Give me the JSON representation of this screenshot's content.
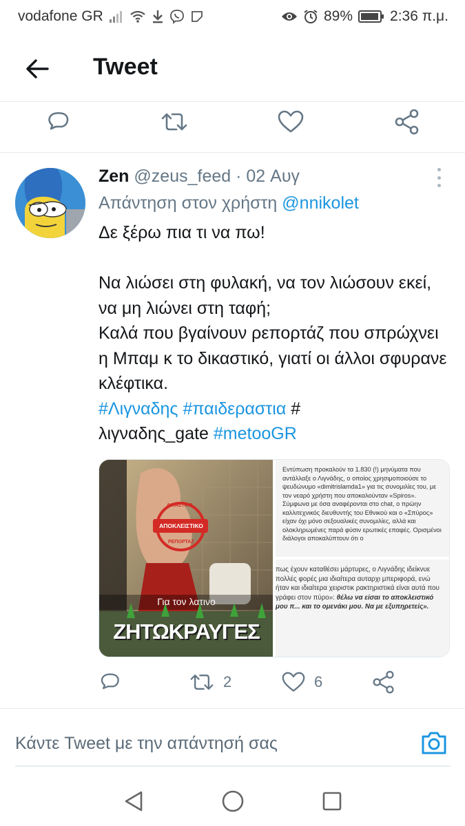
{
  "status_bar": {
    "carrier": "vodafone GR",
    "battery": "89%",
    "time": "2:36 π.μ."
  },
  "header": {
    "title": "Tweet",
    "back_icon": "arrow-left-icon"
  },
  "prev_actions": {
    "icons": [
      "reply-icon",
      "retweet-icon",
      "like-icon",
      "share-icon"
    ]
  },
  "tweet": {
    "display_name": "Zen",
    "handle": "@zeus_feed",
    "separator": "·",
    "date": "02 Αυγ",
    "reply_prefix": "Απάντηση στον χρήστη",
    "reply_to": "@nnikolet",
    "text": {
      "line1": "Δε ξέρω πια τι να πω!",
      "para2": "Να λιώσει στη φυλακή, να τον λιώσουν εκεί, να μη λιώνει στη ταφή;",
      "para3": "Καλά που βγαίνουν ρεπορτάζ που σπρώχνει η Μπαμ κ το δικαστικό, γιατί οι άλλοι σφυρανε κλέφτικα.",
      "hashtag1": "#Λιγναδης",
      "hashtag2": "#παιδεραστια",
      "hashtag3_hash": "#",
      "hashtag3_tail": "λιγναδης_gate",
      "hashtag4": "#metooGR"
    },
    "media": {
      "left_stamp_top": "ΔΙΚΑΣΤΙΚΟ",
      "left_stamp_label": "ΑΠΟΚΛΕΙΣΤΙΚΟ",
      "left_stamp_bottom": "ΡΕΠΟΡΤΑΖ",
      "left_caption": "Για τον λατινο",
      "left_banner": "ΖΗΤΩΚΡΑΥΓΕΣ",
      "doc_top": "Εντύπωση προκαλούν τα 1.830 (!) μηνύματα που αντάλλαξε ο Λιγνάδης, ο οποίος χρησιμοποιούσε το ψευδώνυμο «dimitrislamda1» για τις συνομιλίες του, με τον νεαρό χρήστη που αποκαλούνταν «Spiros». Σύμφωνα με όσα αναφέρονται στο chat, ο πρώην καλλιτεχνικός διευθυντής του Εθνικού και ο «Σπύρος» είχαν όχι μόνο σεξουαλικές συνομιλίες, αλλά και ολοκληρωμένες παρά φύσιν ερωτικές επαφές. Ορισμένοι διάλογοι αποκαλύπτουν ότι ο",
      "doc_bottom_plain": "πως έχουν καταθέσει μάρτυρες, ο Λιγνάδης ιδείκνυε πολλές φορές μια ιδιαίτερα αυταρχι μπεριφορά, ενώ ήταν και ιδιαίτερα χειριστικ ρακτηριστικά είναι αυτά που γράφει στον πύρο»:",
      "doc_bottom_bold": "θέλω να είσαι το αποκλειστικό μου π... και το ομενάκι μου. Να με εξυπηρετείς»."
    },
    "actions": {
      "reply_icon": "reply-icon",
      "retweet_count": "2",
      "like_count": "6",
      "share_icon": "share-icon"
    }
  },
  "compose": {
    "placeholder": "Κάντε Tweet με την απάντησή σας",
    "camera_icon": "camera-icon"
  },
  "nav": {
    "icons": [
      "back-triangle-icon",
      "home-circle-icon",
      "recents-square-icon"
    ]
  },
  "colors": {
    "accent": "#1b95e0",
    "secondary_text": "#657786",
    "divider": "#e6ecf0"
  }
}
